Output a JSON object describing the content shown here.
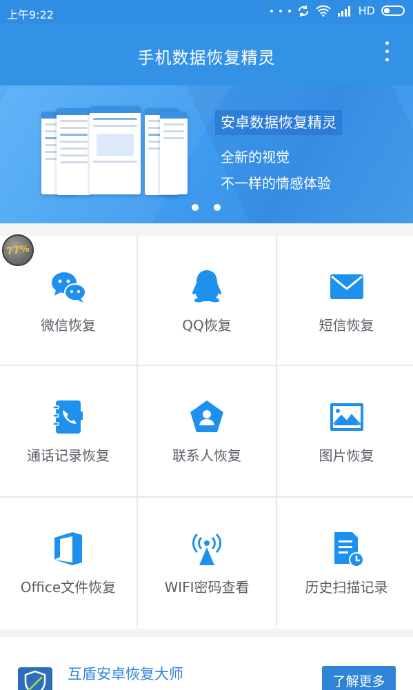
{
  "status_bar": {
    "time": "上午9:22",
    "network": "HD"
  },
  "app_bar": {
    "title": "手机数据恢复精灵"
  },
  "banner": {
    "heading": "安卓数据恢复精灵",
    "line1": "全新的视觉",
    "line2": "不一样的情感体验",
    "page_count": 2
  },
  "badge": {
    "text": "77%"
  },
  "tiles": [
    {
      "label": "微信恢复",
      "icon": "wechat-icon"
    },
    {
      "label": "QQ恢复",
      "icon": "qq-icon"
    },
    {
      "label": "短信恢复",
      "icon": "sms-icon"
    },
    {
      "label": "通话记录恢复",
      "icon": "call-log-icon"
    },
    {
      "label": "联系人恢复",
      "icon": "contact-icon"
    },
    {
      "label": "图片恢复",
      "icon": "image-icon"
    },
    {
      "label": "Office文件恢复",
      "icon": "office-icon"
    },
    {
      "label": "WIFI密码查看",
      "icon": "wifi-icon"
    },
    {
      "label": "历史扫描记录",
      "icon": "history-icon"
    }
  ],
  "promo": {
    "title": "互盾安卓恢复大师",
    "button": "了解更多"
  },
  "colors": {
    "primary": "#3392e6",
    "icon_blue": "#1e90ee",
    "tile_text": "#5a5f66"
  }
}
